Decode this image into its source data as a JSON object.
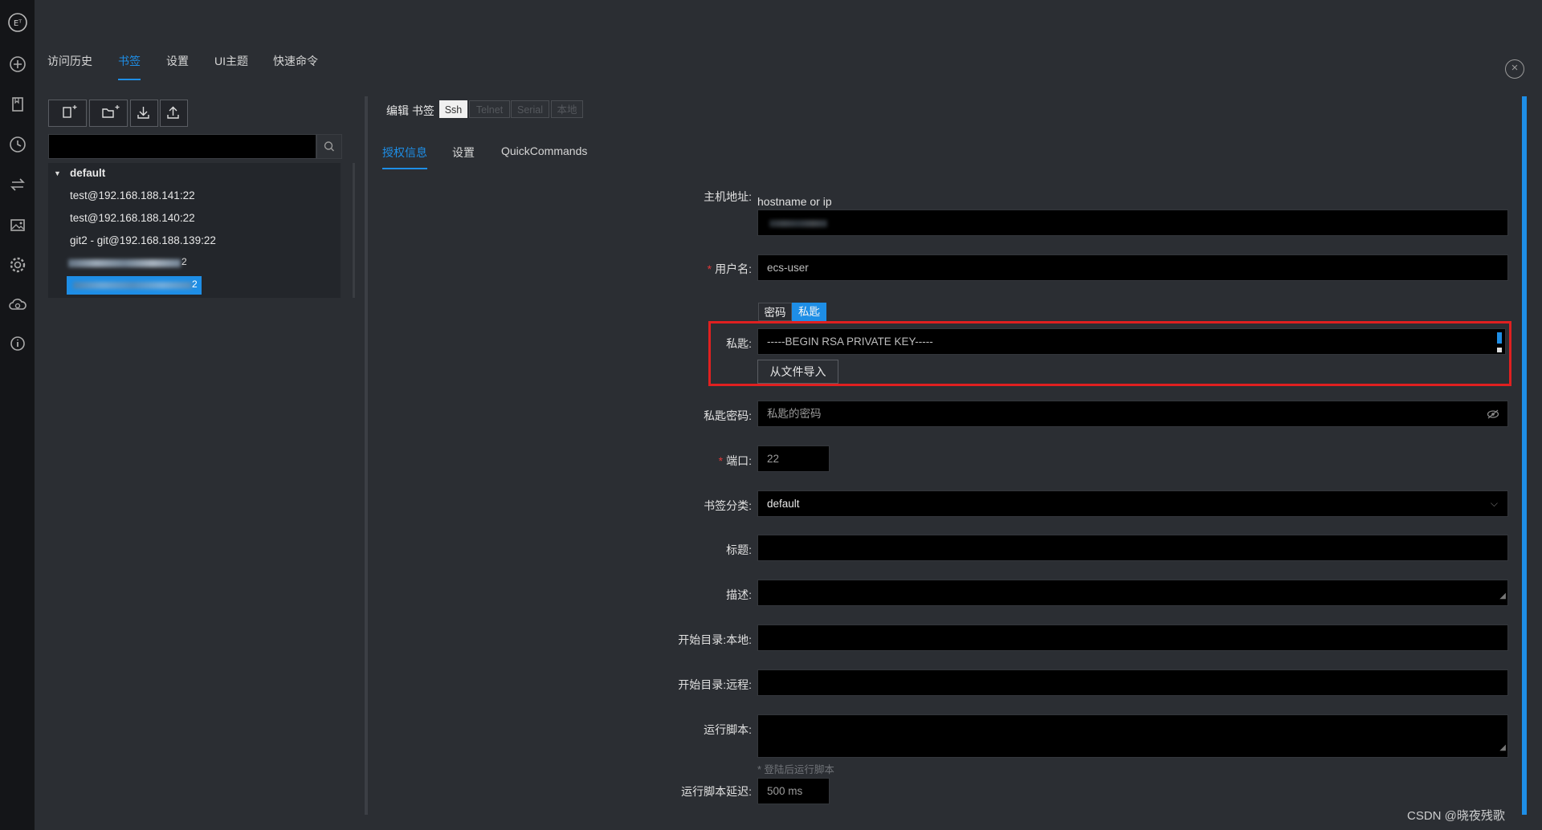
{
  "top_tabs": [
    {
      "label": "访问历史",
      "active": false
    },
    {
      "label": "书签",
      "active": true
    },
    {
      "label": "设置",
      "active": false
    },
    {
      "label": "UI主题",
      "active": false
    },
    {
      "label": "快速命令",
      "active": false
    }
  ],
  "sidebar_icons": [
    "app-logo-icon",
    "add-icon",
    "bookmark-icon",
    "history-icon",
    "transfer-icon",
    "image-icon",
    "settings-icon",
    "cloud-sync-icon",
    "info-icon"
  ],
  "toolbar_icons": [
    "new-bookmark-icon",
    "new-folder-icon",
    "import-icon",
    "export-icon"
  ],
  "tree": {
    "group": "default",
    "items": [
      "test@192.168.188.141:22",
      "test@192.168.188.140:22",
      "git2 - git@192.168.188.139:22"
    ],
    "redacted_item_suffix": "2",
    "selected_item_suffix": "2"
  },
  "editor": {
    "title": "编辑 书签",
    "type_tabs": [
      {
        "label": "Ssh",
        "active": true
      },
      {
        "label": "Telnet",
        "active": false
      },
      {
        "label": "Serial",
        "active": false
      },
      {
        "label": "本地",
        "active": false
      }
    ],
    "sub_tabs": [
      {
        "label": "授权信息",
        "active": true
      },
      {
        "label": "设置",
        "active": false
      },
      {
        "label": "QuickCommands",
        "active": false
      }
    ]
  },
  "form": {
    "host_label": "主机地址:",
    "host_hint": "hostname or ip",
    "username_label": "用户名:",
    "username_value": "ecs-user",
    "auth_tabs": [
      "密码",
      "私匙"
    ],
    "private_key_label": "私匙:",
    "private_key_value": "-----BEGIN RSA PRIVATE KEY-----",
    "import_button": "从文件导入",
    "passphrase_label": "私匙密码:",
    "passphrase_placeholder": "私匙的密码",
    "port_label": "端口:",
    "port_value": "22",
    "category_label": "书签分类:",
    "category_value": "default",
    "title_label": "标题:",
    "description_label": "描述:",
    "local_dir_label": "开始目录:本地:",
    "remote_dir_label": "开始目录:远程:",
    "script_label": "运行脚本:",
    "script_hint": "* 登陆后运行脚本",
    "script_delay_label": "运行脚本延迟:",
    "script_delay_value": "500 ms"
  },
  "watermark": "CSDN @晓夜残歌",
  "colors": {
    "accent": "#1e8ee6",
    "highlight_border": "#e02020",
    "rail_bg": "#141518",
    "main_bg": "#2b2e33"
  }
}
